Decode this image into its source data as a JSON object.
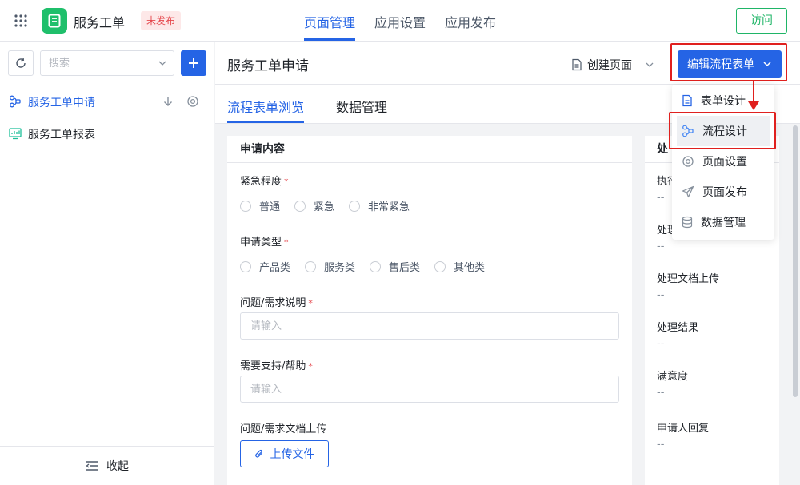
{
  "app": {
    "name": "服务工单",
    "status_badge": "未发布"
  },
  "top_nav": {
    "tabs": [
      "页面管理",
      "应用设置",
      "应用发布"
    ],
    "active_index": 0
  },
  "visit_label": "访问",
  "sidebar": {
    "search_placeholder": "搜索",
    "items": [
      {
        "label": "服务工单申请",
        "icon": "flow-icon",
        "active": true
      },
      {
        "label": "服务工单报表",
        "icon": "report-icon",
        "active": false
      }
    ],
    "collapse_label": "收起"
  },
  "page": {
    "title": "服务工单申请",
    "create_page_label": "创建页面",
    "edit_button_label": "编辑流程表单",
    "tabs": [
      "流程表单浏览",
      "数据管理"
    ],
    "active_tab_index": 0
  },
  "form": {
    "section_title": "申请内容",
    "urgency": {
      "label": "紧急程度",
      "options": [
        "普通",
        "紧急",
        "非常紧急"
      ]
    },
    "request_type": {
      "label": "申请类型",
      "options": [
        "产品类",
        "服务类",
        "售后类",
        "其他类"
      ]
    },
    "problem_desc": {
      "label": "问题/需求说明",
      "placeholder": "请输入"
    },
    "support_needed": {
      "label": "需要支持/帮助",
      "placeholder": "请输入"
    },
    "doc_upload": {
      "label": "问题/需求文档上传",
      "button_label": "上传文件"
    }
  },
  "process_panel": {
    "title": "处",
    "fields": [
      {
        "label": "执行",
        "value": "--"
      },
      {
        "label": "处理",
        "value": "--"
      },
      {
        "label": "处理文档上传",
        "value": "--"
      },
      {
        "label": "处理结果",
        "value": "--"
      },
      {
        "label": "满意度",
        "value": "--"
      },
      {
        "label": "申请人回复",
        "value": "--"
      }
    ]
  },
  "dropdown_menu": {
    "items": [
      {
        "label": "表单设计",
        "icon": "document-icon"
      },
      {
        "label": "流程设计",
        "icon": "flow-icon"
      },
      {
        "label": "页面设置",
        "icon": "settings-icon"
      },
      {
        "label": "页面发布",
        "icon": "send-icon"
      },
      {
        "label": "数据管理",
        "icon": "database-icon"
      }
    ],
    "highlighted_index": 1
  },
  "colors": {
    "primary": "#2564e5",
    "brand_green": "#1fbf6b",
    "annotation_red": "#e0201e"
  }
}
